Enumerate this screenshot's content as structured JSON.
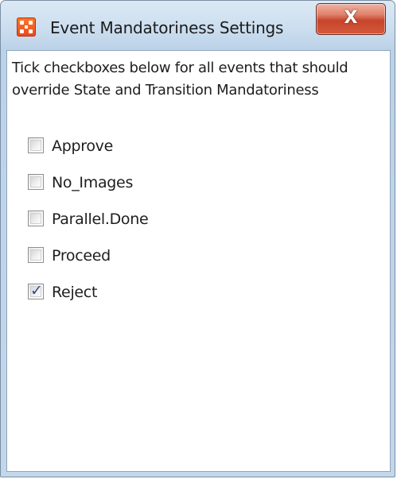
{
  "window": {
    "title": "Event Mandatoriness Settings",
    "close_label": "X",
    "app_icon": "app-grid-icon"
  },
  "description": "Tick checkboxes below for all events that should override State and Transition Mandatoriness",
  "events": [
    {
      "label": "Approve",
      "checked": false
    },
    {
      "label": "No_Images",
      "checked": false
    },
    {
      "label": "Parallel.Done",
      "checked": false
    },
    {
      "label": "Proceed",
      "checked": false
    },
    {
      "label": "Reject",
      "checked": true
    }
  ],
  "colors": {
    "app_icon": "#e8481a",
    "check_mark": "#2e4e8f",
    "close_button": "#c7452a"
  }
}
